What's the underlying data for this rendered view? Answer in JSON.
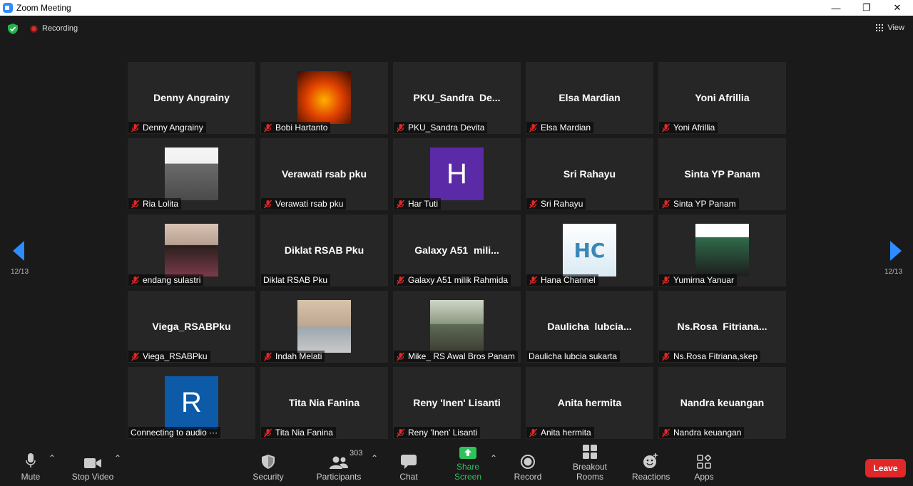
{
  "window": {
    "title": "Zoom Meeting"
  },
  "topbar": {
    "recording_label": "Recording",
    "view_label": "View"
  },
  "pagination": {
    "left": "12/13",
    "right": "12/13"
  },
  "tiles": [
    {
      "big": "Denny Angrainy",
      "label": "Denny Angrainy",
      "muted": true
    },
    {
      "big": "",
      "label": "Bobi Hartanto",
      "muted": true,
      "avatar": "photo-onepiece"
    },
    {
      "big": "PKU_Sandra  De...",
      "label": "PKU_Sandra Devita",
      "muted": true
    },
    {
      "big": "Elsa Mardian",
      "label": "Elsa Mardian",
      "muted": true
    },
    {
      "big": "Yoni Afrillia",
      "label": "Yoni Afrillia",
      "muted": true
    },
    {
      "big": "",
      "label": "Ria Lolita",
      "muted": true,
      "avatar": "photo-hijab"
    },
    {
      "big": "Verawati rsab pku",
      "label": "Verawati rsab pku",
      "muted": true
    },
    {
      "big": "",
      "label": "Har Tuti",
      "muted": true,
      "avatar": "letter",
      "letter": "H",
      "color": "#5b2aa6"
    },
    {
      "big": "Sri Rahayu",
      "label": "Sri Rahayu",
      "muted": true
    },
    {
      "big": "Sinta YP Panam",
      "label": "Sinta YP Panam",
      "muted": true
    },
    {
      "big": "",
      "label": "endang sulastri",
      "muted": true,
      "avatar": "photo-woman"
    },
    {
      "big": "Diklat RSAB Pku",
      "label": "Diklat RSAB Pku",
      "muted": false
    },
    {
      "big": "Galaxy A51  mili...",
      "label": "Galaxy A51 milik Rahmida",
      "muted": true
    },
    {
      "big": "",
      "label": "Hana Channel",
      "muted": true,
      "avatar": "photo-hc"
    },
    {
      "big": "",
      "label": "Yumirna Yanuar",
      "muted": true,
      "avatar": "photo-green-hijab"
    },
    {
      "big": "Viega_RSABPku",
      "label": "Viega_RSABPku",
      "muted": true
    },
    {
      "big": "",
      "label": "Indah Melati",
      "muted": true,
      "avatar": "photo-mask"
    },
    {
      "big": "",
      "label": "Mike_ RS Awal Bros Panam",
      "muted": true,
      "avatar": "photo-outdoor"
    },
    {
      "big": "Daulicha  lubcia...",
      "label": "Daulicha lubcia sukarta",
      "muted": false
    },
    {
      "big": "Ns.Rosa  Fitriana...",
      "label": "Ns.Rosa Fitriana,skep",
      "muted": true
    },
    {
      "big": "",
      "label": "Connecting to audio ···",
      "muted": false,
      "avatar": "letter",
      "letter": "R",
      "color": "#0d5aa8"
    },
    {
      "big": "Tita Nia Fanina",
      "label": "Tita Nia Fanina",
      "muted": true
    },
    {
      "big": "Reny 'Inen' Lisanti",
      "label": "Reny 'Inen' Lisanti",
      "muted": true
    },
    {
      "big": "Anita hermita",
      "label": "Anita hermita",
      "muted": true
    },
    {
      "big": "Nandra keuangan",
      "label": "Nandra keuangan",
      "muted": true
    }
  ],
  "toolbar": {
    "mute": "Mute",
    "stop_video": "Stop Video",
    "security": "Security",
    "participants": "Participants",
    "participants_count": "303",
    "chat": "Chat",
    "share_screen": "Share Screen",
    "record": "Record",
    "breakout_rooms": "Breakout Rooms",
    "reactions": "Reactions",
    "apps": "Apps",
    "leave": "Leave"
  },
  "colors": {
    "accent_green": "#2dc35a",
    "leave_red": "#e02828",
    "tile_bg": "#262626",
    "nav_blue": "#2d8cff"
  }
}
